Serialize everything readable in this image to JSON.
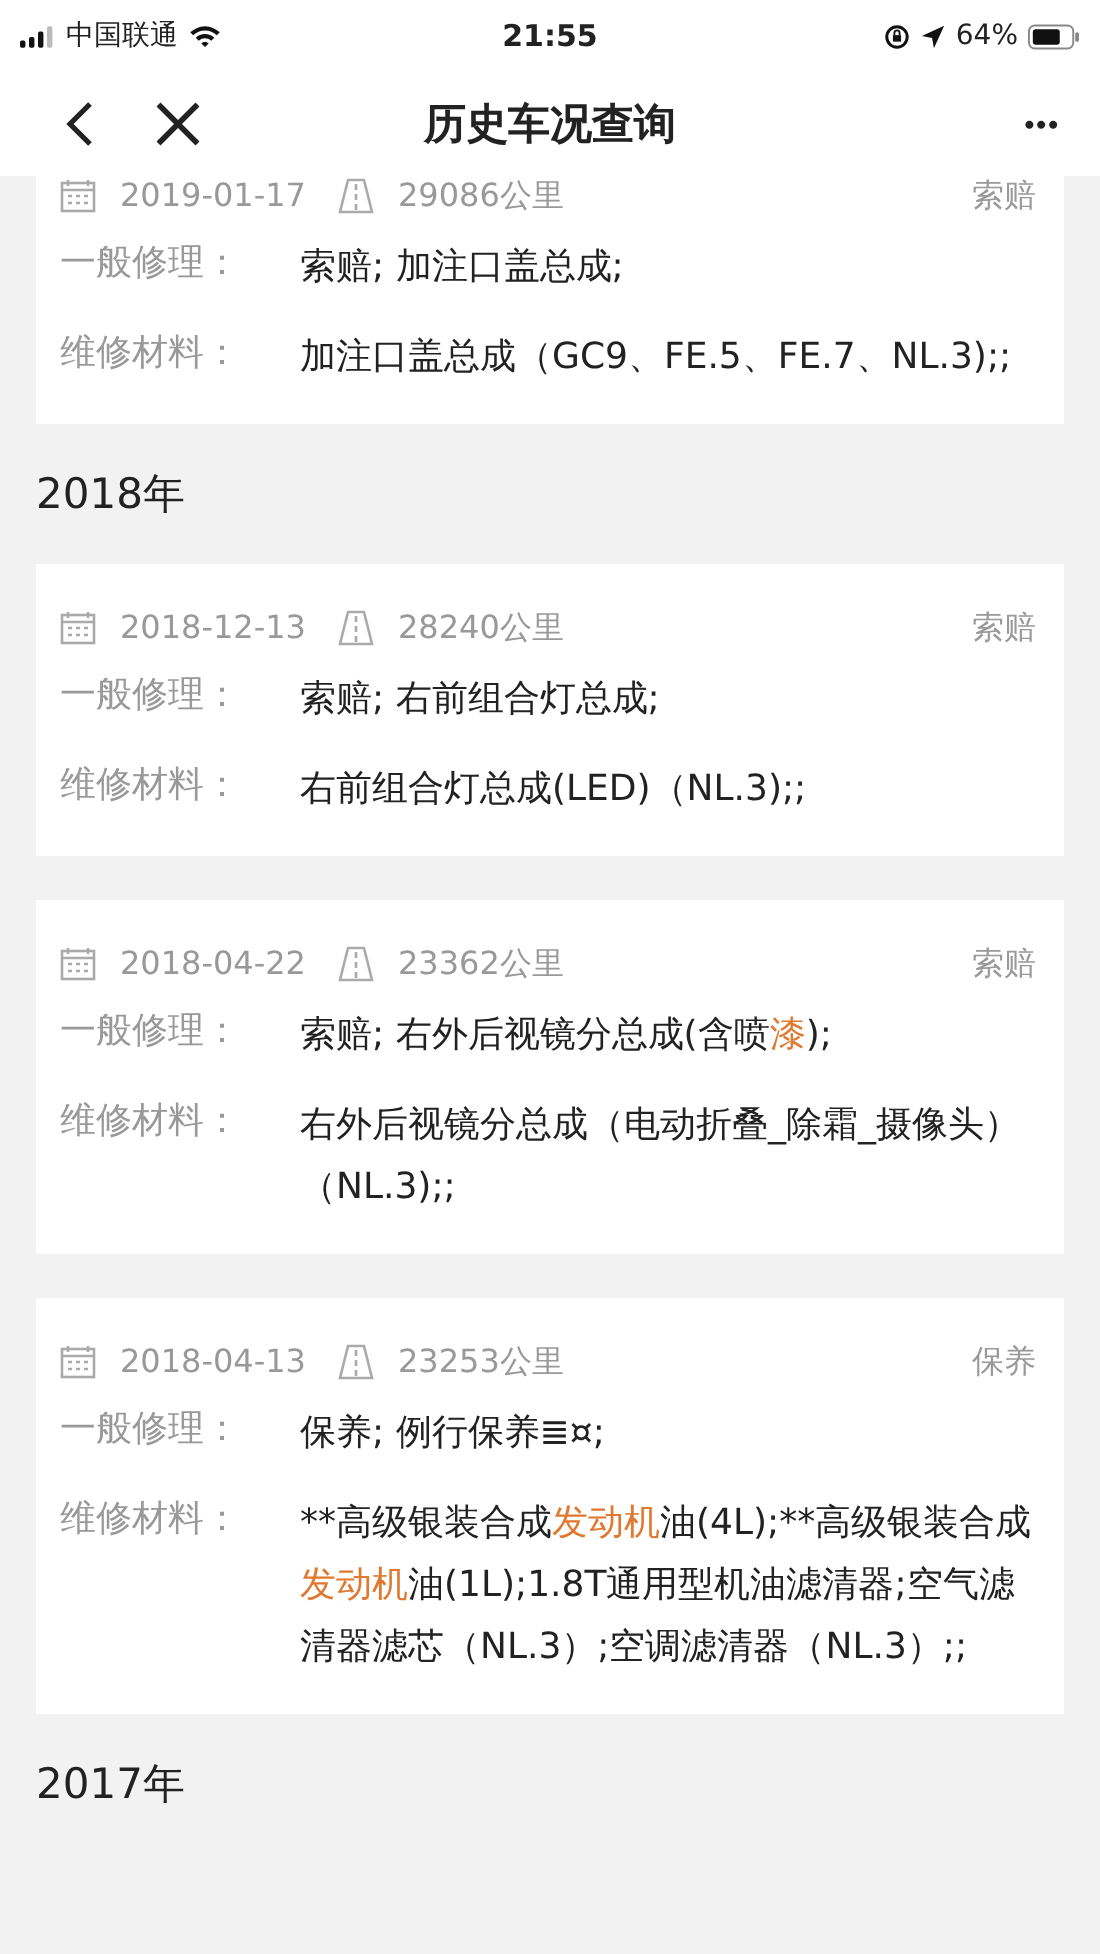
{
  "status_bar": {
    "carrier": "中国联通",
    "time": "21:55",
    "battery": "64%"
  },
  "nav": {
    "title": "历史车况查询",
    "more": "•••"
  },
  "sections": [
    {
      "records": [
        {
          "date": "2019-01-17",
          "mileage": "29086公里",
          "type": "索赔",
          "repair_label": "一般修理：",
          "repair": [
            {
              "text": "索赔; 加注口盖总成;",
              "highlight": false
            }
          ],
          "material_label": "维修材料：",
          "material": [
            {
              "text": "加注口盖总成（GC9、FE.5、FE.7、NL.3);;",
              "highlight": false
            }
          ]
        }
      ]
    },
    {
      "year": "2018年",
      "records": [
        {
          "date": "2018-12-13",
          "mileage": "28240公里",
          "type": "索赔",
          "repair_label": "一般修理：",
          "repair": [
            {
              "text": "索赔; 右前组合灯总成;",
              "highlight": false
            }
          ],
          "material_label": "维修材料：",
          "material": [
            {
              "text": "右前组合灯总成(LED)（NL.3);;",
              "highlight": false
            }
          ]
        },
        {
          "date": "2018-04-22",
          "mileage": "23362公里",
          "type": "索赔",
          "repair_label": "一般修理：",
          "repair": [
            {
              "text": "索赔; 右外后视镜分总成(含喷",
              "highlight": false
            },
            {
              "text": "漆",
              "highlight": true
            },
            {
              "text": ");",
              "highlight": false
            }
          ],
          "material_label": "维修材料：",
          "material": [
            {
              "text": "右外后视镜分总成（电动折叠_除霜_摄像头）（NL.3);;",
              "highlight": false
            }
          ]
        },
        {
          "date": "2018-04-13",
          "mileage": "23253公里",
          "type": "保养",
          "repair_label": "一般修理：",
          "repair": [
            {
              "text": "保养; 例行保养≣¤;",
              "highlight": false
            }
          ],
          "material_label": "维修材料：",
          "material": [
            {
              "text": "**高级银装合成",
              "highlight": false
            },
            {
              "text": "发动机",
              "highlight": true
            },
            {
              "text": "油(4L);**高级银装合成",
              "highlight": false
            },
            {
              "text": "发动机",
              "highlight": true
            },
            {
              "text": "油(1L);1.8T通用型机油滤清器;空气滤清器滤芯（NL.3）;空调滤清器（NL.3）;;",
              "highlight": false
            }
          ]
        }
      ]
    },
    {
      "year": "2017年"
    }
  ]
}
